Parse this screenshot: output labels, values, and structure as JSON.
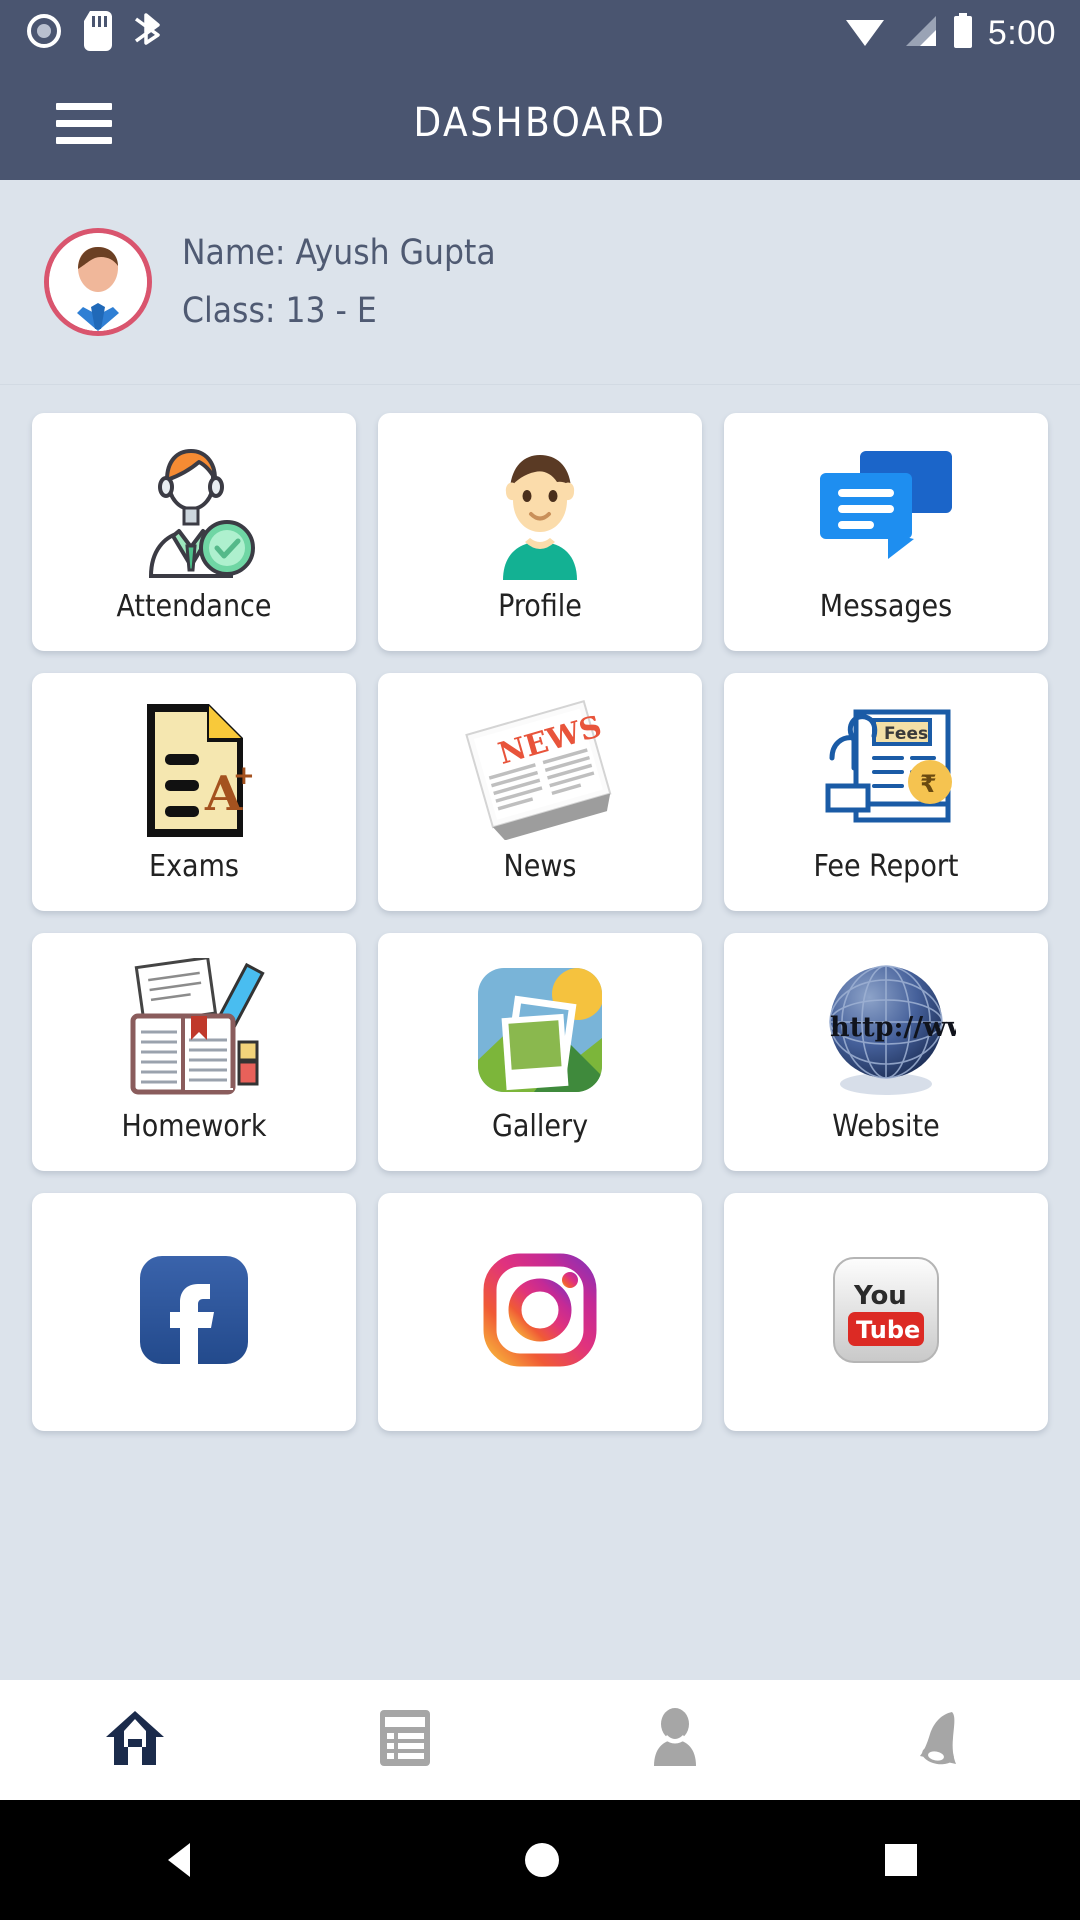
{
  "status_bar": {
    "time": "5:00",
    "icons_left": [
      "screen-recorder-icon",
      "sd-card-icon",
      "bluetooth-share-icon"
    ],
    "icons_right": [
      "wifi-icon",
      "cellular-signal-icon",
      "battery-icon"
    ]
  },
  "app_bar": {
    "title": "DASHBOARD",
    "menu_icon": "hamburger-menu-icon",
    "background": "#4a5570"
  },
  "profile": {
    "avatar_icon": "user-avatar-icon",
    "avatar_border_color": "#d9556e",
    "name_line": "Name: Ayush Gupta",
    "class_line": "Class: 13 - E"
  },
  "grid": {
    "items": [
      {
        "label": "Attendance",
        "icon": "attendance-person-check-icon"
      },
      {
        "label": "Profile",
        "icon": "profile-boy-icon"
      },
      {
        "label": "Messages",
        "icon": "messages-chat-bubbles-icon"
      },
      {
        "label": "Exams",
        "icon": "exams-a-plus-document-icon"
      },
      {
        "label": "News",
        "icon": "news-newspaper-icon"
      },
      {
        "label": "Fee Report",
        "icon": "fee-report-rupee-receipt-icon"
      },
      {
        "label": "Homework",
        "icon": "homework-book-pencil-icon"
      },
      {
        "label": "Gallery",
        "icon": "gallery-photos-icon"
      },
      {
        "label": "Website",
        "icon": "website-globe-http-icon"
      },
      {
        "label": "",
        "icon": "facebook-icon"
      },
      {
        "label": "",
        "icon": "instagram-icon"
      },
      {
        "label": "",
        "icon": "youtube-icon"
      }
    ]
  },
  "bottom_nav": {
    "items": [
      {
        "icon": "home-icon",
        "active": true,
        "color": "#1b2b4b"
      },
      {
        "icon": "list-report-icon",
        "active": false,
        "color": "#a0a0a0"
      },
      {
        "icon": "person-icon",
        "active": false,
        "color": "#a0a0a0"
      },
      {
        "icon": "bell-icon",
        "active": false,
        "color": "#a0a0a0"
      }
    ]
  },
  "android_nav": {
    "back": "back-triangle-icon",
    "home": "home-circle-icon",
    "recents": "recents-square-icon"
  },
  "colors": {
    "app_bar": "#4a5570",
    "page_background": "#dce3eb",
    "card": "#ffffff",
    "accent_pink": "#d9556e",
    "nav_active": "#1b2b4b"
  }
}
